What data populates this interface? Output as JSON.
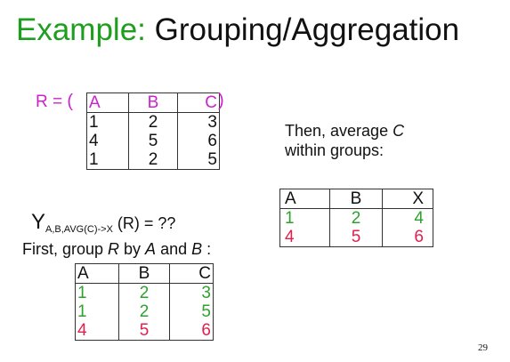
{
  "title": {
    "prefix": "Example:",
    "main": "Grouping/Aggregation"
  },
  "relation_r": {
    "label": "R =",
    "open_paren": "(",
    "close_paren": ")",
    "headers": [
      "A",
      "B",
      "C"
    ],
    "rows": [
      [
        "1",
        "2",
        "3"
      ],
      [
        "4",
        "5",
        "6"
      ],
      [
        "1",
        "2",
        "5"
      ]
    ]
  },
  "then_text": {
    "line1_prefix": "Then, average ",
    "line1_var": "C",
    "line2": "within groups:"
  },
  "result_table": {
    "headers": [
      "A",
      "B",
      "X"
    ],
    "rows": [
      [
        "1",
        "2",
        "4"
      ],
      [
        "4",
        "5",
        "6"
      ]
    ]
  },
  "gamma_expression": {
    "symbol": "Y",
    "subscript": "A,B,AVG(C)->X",
    "rest": " (R) = ??"
  },
  "group_text": {
    "prefix": "First, group ",
    "var_r": "R",
    "middle": " by ",
    "var_a": "A",
    "and": " and ",
    "var_b": "B",
    "suffix": " :"
  },
  "grouped_table": {
    "headers": [
      "A",
      "B",
      "C"
    ],
    "rows": [
      [
        "1",
        "2",
        "3"
      ],
      [
        "1",
        "2",
        "5"
      ],
      [
        "4",
        "5",
        "6"
      ]
    ]
  },
  "page_number": "29",
  "colors": {
    "title_green": "#1e9e1e",
    "magenta": "#cc21cc",
    "group1_green": "#2ea12e",
    "group2_red": "#e0204e"
  }
}
